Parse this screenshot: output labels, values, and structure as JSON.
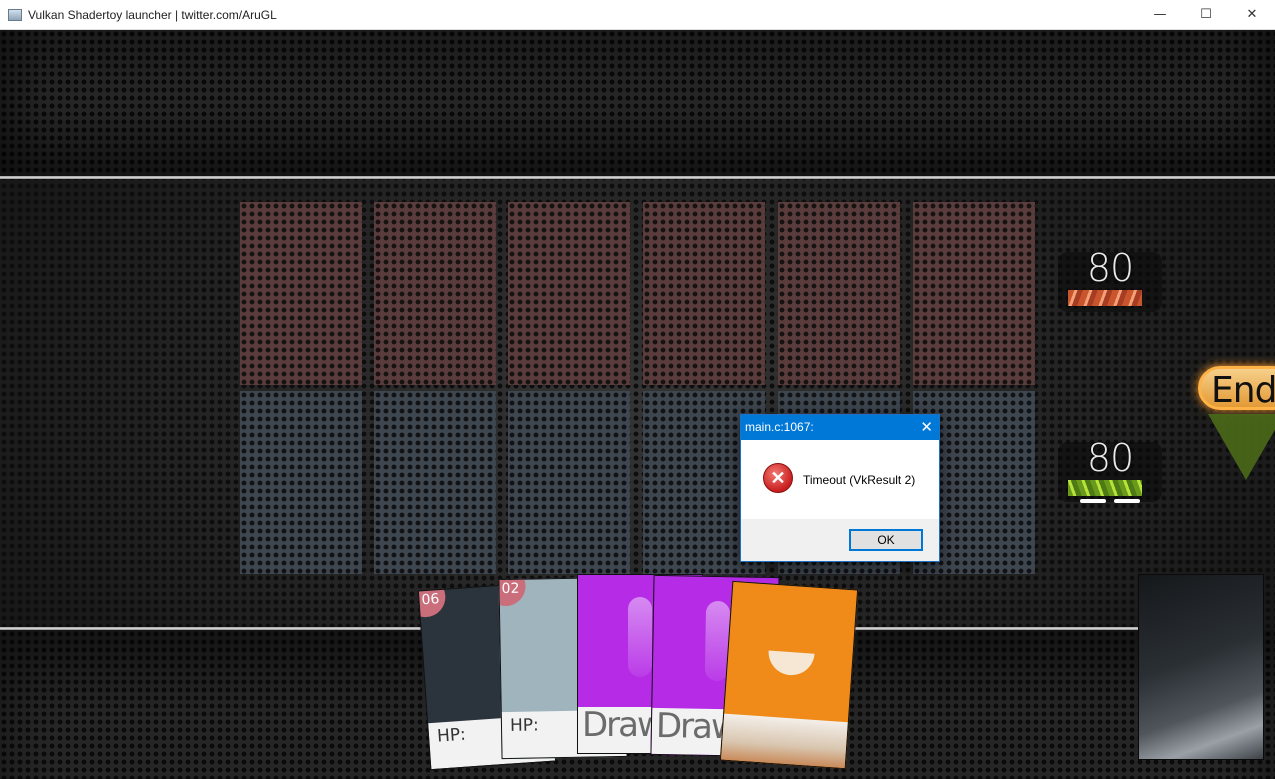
{
  "window": {
    "title": "Vulkan Shadertoy launcher | twitter.com/AruGL",
    "minimize_icon": "—",
    "maximize_icon": "☐",
    "close_icon": "✕"
  },
  "board": {
    "enemy_hp": "80",
    "player_hp": "80",
    "end_turn_label": "End",
    "player_mana_pips": 2
  },
  "hand": {
    "cards": [
      {
        "type": "minion",
        "badge": "06",
        "bottom_label": "HP:",
        "color": "#2b333d"
      },
      {
        "type": "minion",
        "badge": "02",
        "bottom_label": "HP:",
        "color": "#9fb4bd"
      },
      {
        "type": "spell",
        "bottom_label": "Draw",
        "color": "#b52be6"
      },
      {
        "type": "spell",
        "bottom_label": "Draw",
        "color": "#b52be6"
      },
      {
        "type": "spell",
        "color": "#f08a18"
      }
    ]
  },
  "dialog": {
    "title": "main.c:1067:",
    "close_icon": "✕",
    "icon": "error-icon",
    "icon_glyph": "✕",
    "message": "Timeout (VkResult 2)",
    "ok_label": "OK"
  },
  "colors": {
    "dialog_accent": "#0078d7",
    "enemy_slot": "#5a3c3c",
    "player_slot": "#3e4650",
    "end_button": "#e39a36"
  }
}
